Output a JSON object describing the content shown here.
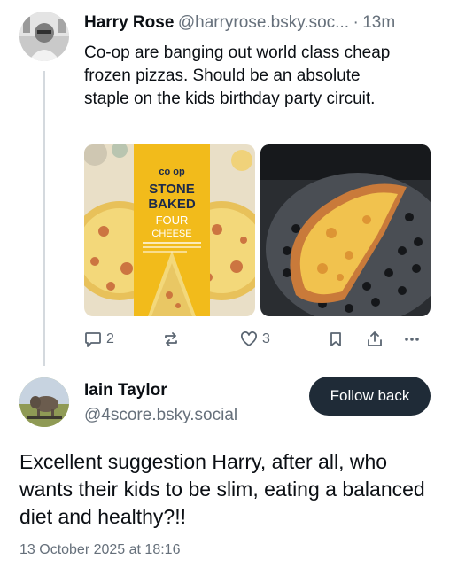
{
  "post": {
    "author_name": "Harry Rose",
    "author_handle": "@harryrose.bsky.soc...",
    "separator": "·",
    "time_ago": "13m",
    "text": "Co-op are banging out world class cheap frozen pizzas. Should be an absolute staple on the kids birthday party circuit.",
    "images": [
      {
        "box_brand": "co op",
        "box_title_line1": "STONE",
        "box_title_line2": "BAKED",
        "box_variety_line1": "FOUR",
        "box_variety_line2": "CHEESE"
      },
      {}
    ],
    "actions": {
      "reply_count": "2",
      "like_count": "3"
    }
  },
  "reply": {
    "author_name": "Iain Taylor",
    "author_handle": "@4score.bsky.social",
    "follow_label": "Follow back",
    "text": "Excellent suggestion Harry, after all, who wants their kids to be slim, eating a balanced diet and healthy?!!",
    "timestamp": "13 October 2025 at 18:16"
  },
  "icons": {
    "reply": "reply-icon",
    "repost": "repost-icon",
    "like": "heart-icon",
    "bookmark": "bookmark-icon",
    "share": "share-icon",
    "more": "more-icon"
  },
  "colors": {
    "accent_dark": "#1f2b37",
    "muted_text": "#66707b",
    "thread_line": "#d4d9de",
    "box_yellow": "#f2bb1b"
  }
}
